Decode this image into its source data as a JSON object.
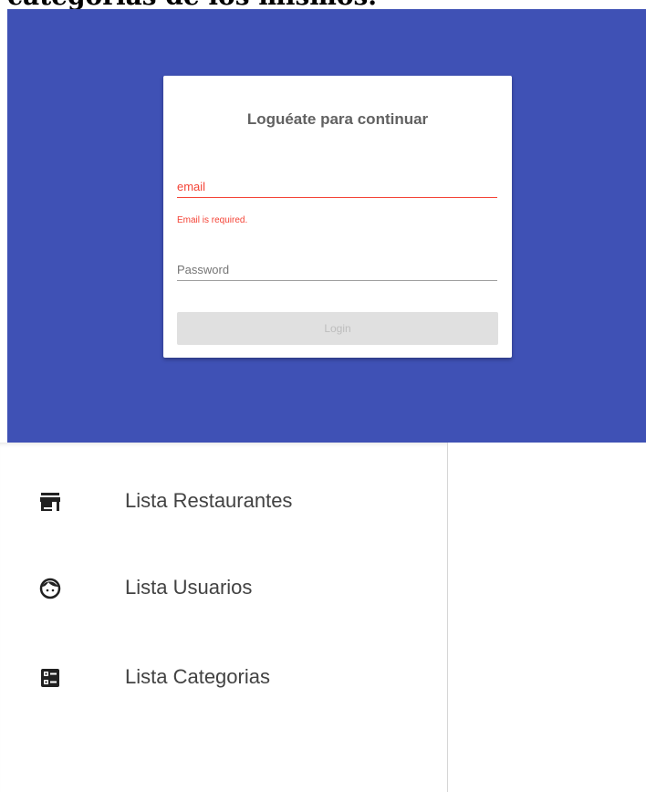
{
  "page_heading_partial": "categorías de los mismos.",
  "login": {
    "title": "Loguéate para continuar",
    "email_placeholder": "email",
    "email_error": "Email is required.",
    "password_placeholder": "Password",
    "button_label": "Login"
  },
  "colors": {
    "panel_background": "#3f51b5",
    "error": "#f44336",
    "button_disabled": "#e0e0e0"
  },
  "menu": {
    "items": [
      {
        "label": "Lista Restaurantes",
        "icon": "store-icon"
      },
      {
        "label": "Lista Usuarios",
        "icon": "face-icon"
      },
      {
        "label": "Lista Categorias",
        "icon": "dashboard-list-icon"
      }
    ]
  }
}
